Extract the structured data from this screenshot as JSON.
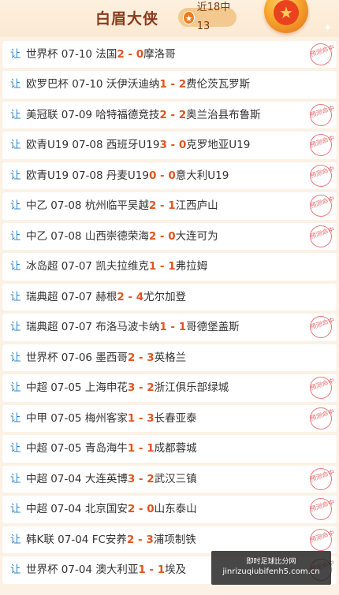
{
  "header": {
    "title": "白眉大侠",
    "streak_label": "近18中13",
    "star_glyph": "★"
  },
  "rang_label": "让",
  "stamp_text": "预测命中",
  "matches": [
    {
      "league": "世界杯",
      "date": "07-10",
      "home": "法国",
      "home_score": "2",
      "sep": " - ",
      "away_score": "0",
      "away": "摩洛哥",
      "hit": true
    },
    {
      "league": "欧罗巴杯",
      "date": "07-10",
      "home": "沃伊沃迪纳",
      "home_score": "1",
      "sep": " - ",
      "away_score": "2",
      "away": "费伦茨瓦罗斯",
      "hit": false
    },
    {
      "league": "美冠联",
      "date": "07-09",
      "home": "哈特福德竞技",
      "home_score": "2",
      "sep": " - ",
      "away_score": "2",
      "away": "奥兰治县布鲁斯",
      "hit": true
    },
    {
      "league": "欧青U19",
      "date": "07-08",
      "home": "西班牙U19",
      "home_score": "3",
      "sep": " - ",
      "away_score": "0",
      "away": "克罗地亚U19",
      "hit": true
    },
    {
      "league": "欧青U19",
      "date": "07-08",
      "home": "丹麦U19",
      "home_score": "0",
      "sep": " - ",
      "away_score": "0",
      "away": "意大利U19",
      "hit": true
    },
    {
      "league": "中乙",
      "date": "07-08",
      "home": "杭州临平吴越",
      "home_score": "2",
      "sep": " - ",
      "away_score": "1",
      "away": "江西庐山",
      "hit": true
    },
    {
      "league": "中乙",
      "date": "07-08",
      "home": "山西崇德荣海",
      "home_score": "2",
      "sep": " - ",
      "away_score": "0",
      "away": "大连可为",
      "hit": true
    },
    {
      "league": "冰岛超",
      "date": "07-07",
      "home": "凯夫拉维克",
      "home_score": "1",
      "sep": " - ",
      "away_score": "1",
      "away": "弗拉姆",
      "hit": false
    },
    {
      "league": "瑞典超",
      "date": "07-07",
      "home": "赫根",
      "home_score": "2",
      "sep": " - ",
      "away_score": "4",
      "away": "尤尔加登",
      "hit": false
    },
    {
      "league": "瑞典超",
      "date": "07-07",
      "home": "布洛马波卡纳",
      "home_score": "1",
      "sep": " - ",
      "away_score": "1",
      "away": "哥德堡盖斯",
      "hit": true
    },
    {
      "league": "世界杯",
      "date": "07-06",
      "home": "墨西哥",
      "home_score": "2",
      "sep": " - ",
      "away_score": "3",
      "away": "英格兰",
      "hit": false
    },
    {
      "league": "中超",
      "date": "07-05",
      "home": "上海申花",
      "home_score": "3",
      "sep": " - ",
      "away_score": "2",
      "away": "浙江俱乐部绿城",
      "hit": true
    },
    {
      "league": "中甲",
      "date": "07-05",
      "home": "梅州客家",
      "home_score": "1",
      "sep": " - ",
      "away_score": "3",
      "away": "长春亚泰",
      "hit": true
    },
    {
      "league": "中超",
      "date": "07-05",
      "home": "青岛海牛",
      "home_score": "1",
      "sep": " - ",
      "away_score": "1",
      "away": "成都蓉城",
      "hit": false
    },
    {
      "league": "中超",
      "date": "07-04",
      "home": "大连英博",
      "home_score": "3",
      "sep": " - ",
      "away_score": "2",
      "away": "武汉三镇",
      "hit": true
    },
    {
      "league": "中超",
      "date": "07-04",
      "home": "北京国安",
      "home_score": "2",
      "sep": " - ",
      "away_score": "0",
      "away": "山东泰山",
      "hit": true
    },
    {
      "league": "韩K联",
      "date": "07-04",
      "home": "FC安养",
      "home_score": "2",
      "sep": " - ",
      "away_score": "3",
      "away": "浦项制铁",
      "hit": true
    },
    {
      "league": "世界杯",
      "date": "07-04",
      "home": "澳大利亚",
      "home_score": "1",
      "sep": " - ",
      "away_score": "1",
      "away": "埃及",
      "hit": true
    }
  ],
  "watermark": {
    "line1": "即时足球比分网",
    "line2": "jinrizuqiubifenh5.com.cn"
  }
}
